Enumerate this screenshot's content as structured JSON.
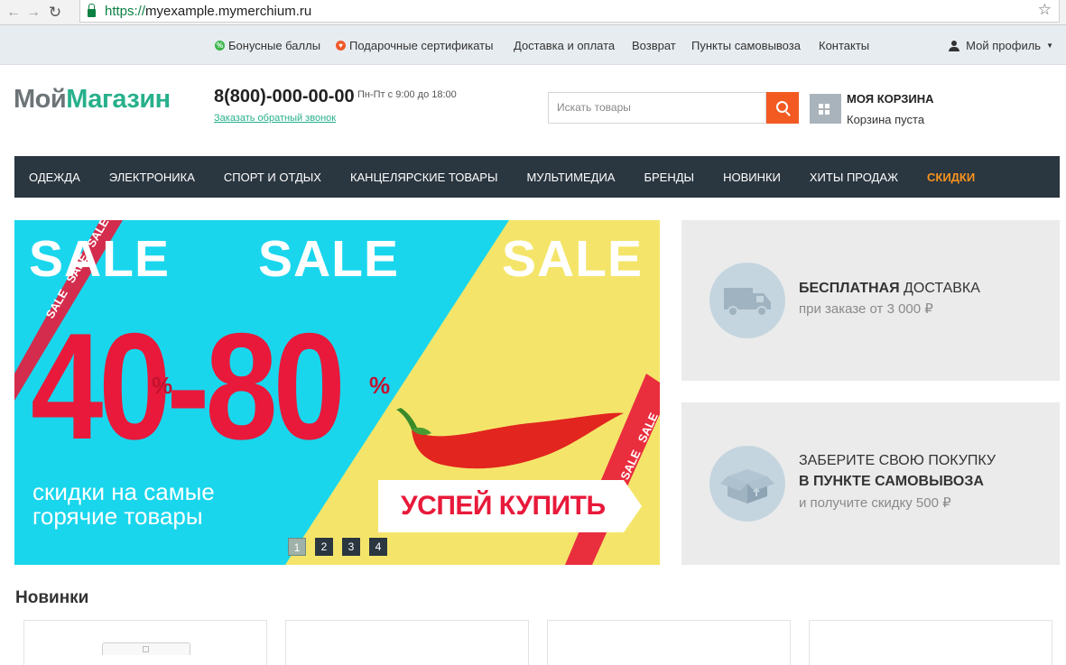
{
  "browser": {
    "url_scheme": "https://",
    "url_host": "myexample.mymerchium.ru"
  },
  "topbar": {
    "links": [
      {
        "label": "Бонусные баллы",
        "icon": "percent-icon",
        "color": "#39b54a"
      },
      {
        "label": "Подарочные сертификаты",
        "icon": "heart-icon",
        "color": "#ef5a28"
      },
      {
        "label": "Доставка и оплата"
      },
      {
        "label": "Возврат"
      },
      {
        "label": "Пункты самовывоза"
      },
      {
        "label": "Контакты"
      }
    ],
    "profile_label": "Мой профиль"
  },
  "header": {
    "logo_part1": "Мой",
    "logo_part2": "Магазин",
    "phone": "8(800)-000-00-00",
    "hours": "Пн-Пт с 9:00 до 18:00",
    "callback": "Заказать обратный звонок",
    "search_placeholder": "Искать товары",
    "cart_title": "МОЯ КОРЗИНА",
    "cart_status": "Корзина пуста"
  },
  "nav": {
    "items": [
      {
        "label": "ОДЕЖДА"
      },
      {
        "label": "ЭЛЕКТРОНИКА"
      },
      {
        "label": "СПОРТ И ОТДЫХ"
      },
      {
        "label": "КАНЦЕЛЯРСКИЕ ТОВАРЫ"
      },
      {
        "label": "МУЛЬТИМЕДИА"
      },
      {
        "label": "БРЕНДЫ"
      },
      {
        "label": "НОВИНКИ"
      },
      {
        "label": "ХИТЫ ПРОДАЖ"
      },
      {
        "label": "СКИДКИ",
        "accent": "#f7931e"
      }
    ]
  },
  "banner": {
    "sale_word": "SALE",
    "big_left": "40",
    "dash": "-",
    "big_right": "80",
    "percent": "%",
    "tagline": "скидки на самые горячие товары",
    "cta": "УСПЕЙ КУПИТЬ",
    "colors": {
      "cyan": "#19d6ed",
      "yellow": "#f4e56a",
      "red": "#e8193a"
    },
    "slides": [
      "1",
      "2",
      "3",
      "4"
    ],
    "active_slide": 1
  },
  "promos": [
    {
      "title_bold": "БЕСПЛАТНАЯ",
      "title_rest": " ДОСТАВКА",
      "sub": "при заказе от 3 000 ₽",
      "icon": "truck-icon"
    },
    {
      "line1": "ЗАБЕРИТЕ СВОЮ ПОКУПКУ",
      "line2": "В ПУНКТЕ САМОВЫВОЗА",
      "sub": "и получите скидку 500 ₽",
      "icon": "box-icon"
    }
  ],
  "new_products": {
    "title": "Новинки"
  }
}
